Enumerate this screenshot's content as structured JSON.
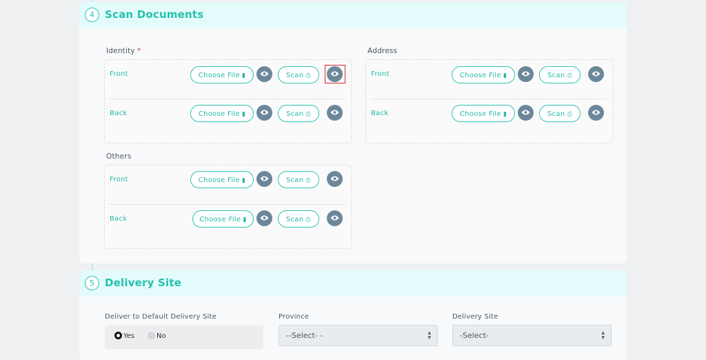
{
  "scan_section": {
    "step": "4",
    "title": "Scan Documents",
    "groups": {
      "identity": {
        "label": "Identity",
        "required_mark": "*",
        "rows": [
          {
            "label": "Front",
            "choose": "Choose File",
            "scan": "Scan"
          },
          {
            "label": "Back",
            "choose": "Choose File",
            "scan": "Scan"
          }
        ]
      },
      "address": {
        "label": "Address",
        "rows": [
          {
            "label": "Front",
            "choose": "Choose File",
            "scan": "Scan"
          },
          {
            "label": "Back",
            "choose": "Choose File",
            "scan": "Scan"
          }
        ]
      },
      "others": {
        "label": "Others",
        "rows": [
          {
            "label": "Front",
            "choose": "Choose File",
            "scan": "Scan"
          },
          {
            "label": "Back",
            "choose": "Choose File",
            "scan": "Scan"
          }
        ]
      }
    },
    "icons": {
      "file": "file-icon",
      "scan": "printer-icon",
      "preview": "eye-icon"
    }
  },
  "delivery_section": {
    "step": "5",
    "title": "Delivery Site",
    "default_site": {
      "label": "Deliver to Default Delivery Site",
      "yes": "Yes",
      "no": "No",
      "selected": "Yes"
    },
    "province": {
      "label": "Province",
      "value": "--Select- -"
    },
    "site": {
      "label": "Delivery Site",
      "value": "-Select-"
    }
  },
  "colors": {
    "accent": "#25c3af",
    "header_bg": "#e4fbfb",
    "eye_button": "#6c8799",
    "highlight": "#d9242c"
  }
}
